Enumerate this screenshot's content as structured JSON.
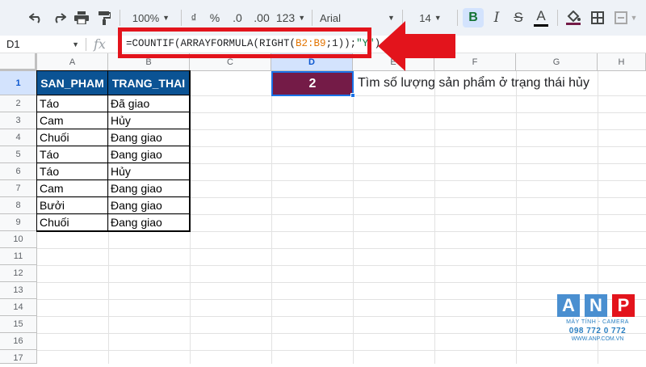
{
  "toolbar": {
    "zoom": "100%",
    "currency": "₫",
    "percent": "%",
    "dec_decrease": ".0",
    "dec_increase": ".00",
    "num_format": "123",
    "font": "Arial",
    "font_size": "14",
    "bold": "B",
    "text_color_letter": "A"
  },
  "formula_bar": {
    "name_box": "D1",
    "fx": "fx",
    "formula_prefix": "=COUNTIF(ARRAYFORMULA(RIGHT(",
    "formula_range": "B2:B9",
    "formula_mid": ";1));",
    "formula_string": "\"Y\"",
    "formula_suffix": ")"
  },
  "columns": [
    "A",
    "B",
    "C",
    "D",
    "E",
    "F",
    "G",
    "H"
  ],
  "rows": [
    "1",
    "2",
    "3",
    "4",
    "5",
    "6",
    "7",
    "8",
    "9",
    "10",
    "11",
    "12",
    "13",
    "14",
    "15",
    "16",
    "17"
  ],
  "table": {
    "headers": [
      "SAN_PHAM",
      "TRANG_THAI"
    ],
    "rows": [
      [
        "Táo",
        "Đã giao"
      ],
      [
        "Cam",
        "Hủy"
      ],
      [
        "Chuối",
        "Đang giao"
      ],
      [
        "Táo",
        "Đang giao"
      ],
      [
        "Táo",
        "Hủy"
      ],
      [
        "Cam",
        "Đang giao"
      ],
      [
        "Bưởi",
        "Đang giao"
      ],
      [
        "Chuối",
        "Đang giao"
      ]
    ]
  },
  "result": {
    "value": "2",
    "note": "Tìm số lượng sản phẩm ở trạng thái hủy"
  },
  "logo": {
    "letters": [
      "A",
      "N",
      "P"
    ],
    "tagline": "MÁY TÍNH - CAMERA",
    "phone": "098 772 0 772",
    "website": "WWW.ANP.COM.VN"
  },
  "colors": {
    "header_fill": "#0b5394",
    "result_fill": "#741b47",
    "highlight": "#e3141c",
    "logo_blue": "#4a8fd0",
    "logo_red": "#e3141c"
  }
}
